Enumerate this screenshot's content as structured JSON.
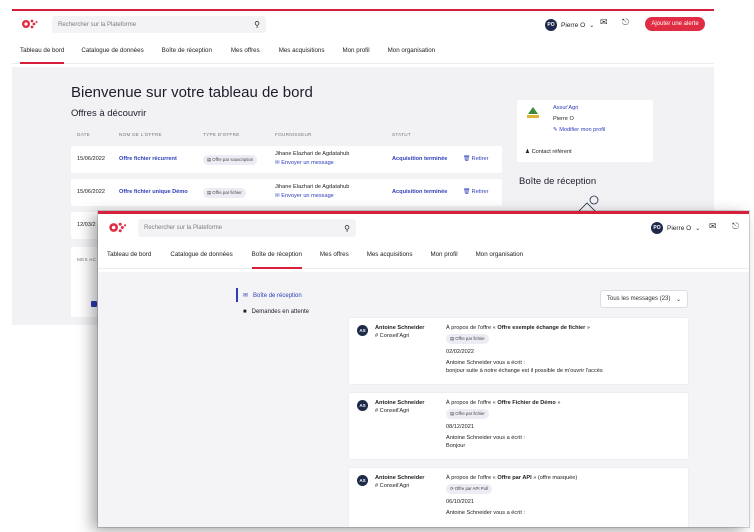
{
  "back_window": {
    "search_placeholder": "Rechercher sur la Plateforme",
    "user": {
      "initials": "PO",
      "name": "Pierre O"
    },
    "alert_button": "Ajouter une alerte",
    "nav": [
      "Tableau de bord",
      "Catalogue de données",
      "Boîte de réception",
      "Mes offres",
      "Mes acquisitions",
      "Mon profil",
      "Mon organisation"
    ],
    "title": "Bienvenue sur votre tableau de bord",
    "section_title": "Offres à découvrir",
    "table": {
      "headers": [
        "DATE",
        "NOM DE L'OFFRE",
        "TYPE D'OFFRE",
        "FOURNISSEUR",
        "STATUT"
      ],
      "rows": [
        {
          "date": "15/06/2022",
          "name": "Offre fichier récurrent",
          "type": "Offre par souscription",
          "supplier_line": "Jihane Elazhari de Agdatahub",
          "send": "Envoyer un message",
          "status": "Acquisition terminée",
          "remove": "Retirer"
        },
        {
          "date": "15/06/2022",
          "name": "Offre fichier unique Démo",
          "type": "Offre par fichier",
          "supplier_line": "Jihane Elazhari de Agdatahub",
          "send": "Envoyer un message",
          "status": "Acquisition terminée",
          "remove": "Retirer"
        },
        {
          "date": "12/03/2"
        }
      ]
    },
    "messages_label": "MES AC",
    "profile": {
      "org": "Assur'Agri",
      "user": "Pierre O",
      "edit": "Modifier mon profil",
      "referent": "Contact référent"
    },
    "inbox_title": "Boîte de réception"
  },
  "front_window": {
    "search_placeholder": "Rechercher sur la Plateforme",
    "user": {
      "initials": "PO",
      "name": "Pierre O"
    },
    "nav": [
      "Tableau de bord",
      "Catalogue de données",
      "Boîte de réception",
      "Mes offres",
      "Mes acquisitions",
      "Mon profil",
      "Mon organisation"
    ],
    "sidebar": [
      "Boîte de réception",
      "Demandes en attente"
    ],
    "filter": "Tous les messages (23)",
    "messages": [
      {
        "initials": "AS",
        "sender": "Antoine Schneider",
        "org": "# Conseil'Agri",
        "about_pre": "À propos de l'offre « ",
        "offer": "Offre exemple échange de fichier",
        "about_post": " »",
        "chip": "Offre par fichier",
        "date": "02/02/2022",
        "wrote": "Antoine Schneider vous a écrit :",
        "body": "bonjour suite à notre échange est il possible de m'ouvrir l'accès"
      },
      {
        "initials": "AS",
        "sender": "Antoine Schneider",
        "org": "# Conseil'Agri",
        "about_pre": "À propos de l'offre « ",
        "offer": "Offre Fichier de Démo",
        "about_post": " »",
        "chip": "Offre par fichier",
        "date": "08/12/2021",
        "wrote": "Antoine Schneider vous a écrit :",
        "body": "Bonjour"
      },
      {
        "initials": "AS",
        "sender": "Antoine Schneider",
        "org": "# Conseil'Agri",
        "about_pre": "À propos de l'offre « ",
        "offer": "Offre par API",
        "about_post": " » (offre masquée)",
        "chip": "Offre par API Poll",
        "date": "06/10/2021",
        "wrote": "Antoine Schneider vous a écrit :",
        "body": ""
      }
    ]
  },
  "colors": {
    "brand": "#d6203b",
    "link": "#2c3db8",
    "avatar": "#1e2a4a"
  }
}
